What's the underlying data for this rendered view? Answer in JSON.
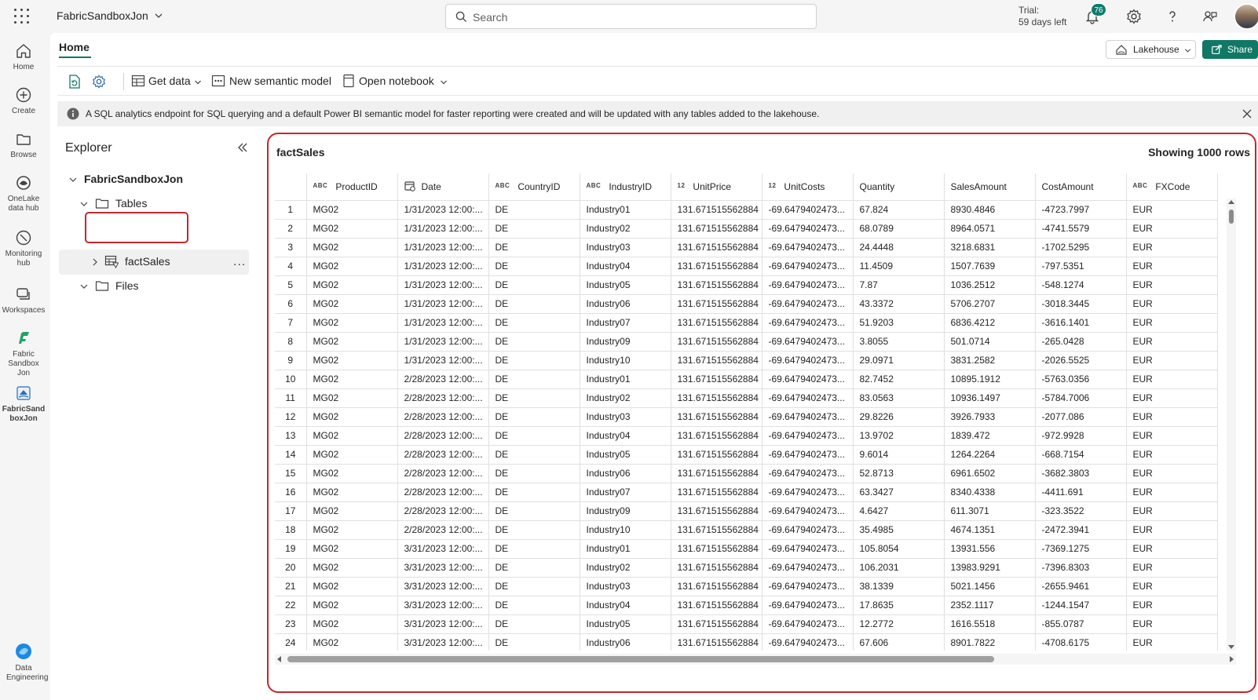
{
  "topbar": {
    "workspace": "FabricSandboxJon",
    "search_placeholder": "Search",
    "trial_line1": "Trial:",
    "trial_line2": "59 days left",
    "notification_count": "76"
  },
  "rail": [
    {
      "label": "Home",
      "icon": "home-icon"
    },
    {
      "label": "Create",
      "icon": "create-icon"
    },
    {
      "label": "Browse",
      "icon": "browse-icon"
    },
    {
      "label": "OneLake data hub",
      "icon": "onelake-icon"
    },
    {
      "label": "Monitoring hub",
      "icon": "monitoring-icon"
    },
    {
      "label": "Workspaces",
      "icon": "workspaces-icon"
    },
    {
      "label": "Fabric Sandbox Jon",
      "icon": "fabric-icon"
    },
    {
      "label": "FabricSandboxJon",
      "icon": "lakehouse-icon"
    },
    {
      "label": "Data Engineering",
      "icon": "data-engineering-icon"
    }
  ],
  "ribbon": {
    "tab": "Home",
    "lakehouse_label": "Lakehouse",
    "share_label": "Share",
    "get_data": "Get data",
    "new_semantic_model": "New semantic model",
    "open_notebook": "Open notebook"
  },
  "info": {
    "message": "A SQL analytics endpoint for SQL querying and a default Power BI semantic model for faster reporting were created and will be updated with any tables added to the lakehouse."
  },
  "explorer": {
    "title": "Explorer",
    "root": "FabricSandboxJon",
    "tables": "Tables",
    "table_item": "factSales",
    "files": "Files",
    "more": "..."
  },
  "grid": {
    "title": "factSales",
    "count": "Showing 1000 rows",
    "columns": [
      {
        "type": "ABC",
        "name": "ProductID"
      },
      {
        "type": "date",
        "name": "Date"
      },
      {
        "type": "ABC",
        "name": "CountryID"
      },
      {
        "type": "ABC",
        "name": "IndustryID"
      },
      {
        "type": "12",
        "name": "UnitPrice"
      },
      {
        "type": "12",
        "name": "UnitCosts"
      },
      {
        "type": "",
        "name": "Quantity"
      },
      {
        "type": "",
        "name": "SalesAmount"
      },
      {
        "type": "",
        "name": "CostAmount"
      },
      {
        "type": "ABC",
        "name": "FXCode"
      }
    ],
    "rows": [
      [
        "1",
        "MG02",
        "1/31/2023 12:00:...",
        "DE",
        "Industry01",
        "131.671515562884",
        "-69.6479402473...",
        "67.824",
        "8930.4846",
        "-4723.7997",
        "EUR"
      ],
      [
        "2",
        "MG02",
        "1/31/2023 12:00:...",
        "DE",
        "Industry02",
        "131.671515562884",
        "-69.6479402473...",
        "68.0789",
        "8964.0571",
        "-4741.5579",
        "EUR"
      ],
      [
        "3",
        "MG02",
        "1/31/2023 12:00:...",
        "DE",
        "Industry03",
        "131.671515562884",
        "-69.6479402473...",
        "24.4448",
        "3218.6831",
        "-1702.5295",
        "EUR"
      ],
      [
        "4",
        "MG02",
        "1/31/2023 12:00:...",
        "DE",
        "Industry04",
        "131.671515562884",
        "-69.6479402473...",
        "11.4509",
        "1507.7639",
        "-797.5351",
        "EUR"
      ],
      [
        "5",
        "MG02",
        "1/31/2023 12:00:...",
        "DE",
        "Industry05",
        "131.671515562884",
        "-69.6479402473...",
        "7.87",
        "1036.2512",
        "-548.1274",
        "EUR"
      ],
      [
        "6",
        "MG02",
        "1/31/2023 12:00:...",
        "DE",
        "Industry06",
        "131.671515562884",
        "-69.6479402473...",
        "43.3372",
        "5706.2707",
        "-3018.3445",
        "EUR"
      ],
      [
        "7",
        "MG02",
        "1/31/2023 12:00:...",
        "DE",
        "Industry07",
        "131.671515562884",
        "-69.6479402473...",
        "51.9203",
        "6836.4212",
        "-3616.1401",
        "EUR"
      ],
      [
        "8",
        "MG02",
        "1/31/2023 12:00:...",
        "DE",
        "Industry09",
        "131.671515562884",
        "-69.6479402473...",
        "3.8055",
        "501.0714",
        "-265.0428",
        "EUR"
      ],
      [
        "9",
        "MG02",
        "1/31/2023 12:00:...",
        "DE",
        "Industry10",
        "131.671515562884",
        "-69.6479402473...",
        "29.0971",
        "3831.2582",
        "-2026.5525",
        "EUR"
      ],
      [
        "10",
        "MG02",
        "2/28/2023 12:00:...",
        "DE",
        "Industry01",
        "131.671515562884",
        "-69.6479402473...",
        "82.7452",
        "10895.1912",
        "-5763.0356",
        "EUR"
      ],
      [
        "11",
        "MG02",
        "2/28/2023 12:00:...",
        "DE",
        "Industry02",
        "131.671515562884",
        "-69.6479402473...",
        "83.0563",
        "10936.1497",
        "-5784.7006",
        "EUR"
      ],
      [
        "12",
        "MG02",
        "2/28/2023 12:00:...",
        "DE",
        "Industry03",
        "131.671515562884",
        "-69.6479402473...",
        "29.8226",
        "3926.7933",
        "-2077.086",
        "EUR"
      ],
      [
        "13",
        "MG02",
        "2/28/2023 12:00:...",
        "DE",
        "Industry04",
        "131.671515562884",
        "-69.6479402473...",
        "13.9702",
        "1839.472",
        "-972.9928",
        "EUR"
      ],
      [
        "14",
        "MG02",
        "2/28/2023 12:00:...",
        "DE",
        "Industry05",
        "131.671515562884",
        "-69.6479402473...",
        "9.6014",
        "1264.2264",
        "-668.7154",
        "EUR"
      ],
      [
        "15",
        "MG02",
        "2/28/2023 12:00:...",
        "DE",
        "Industry06",
        "131.671515562884",
        "-69.6479402473...",
        "52.8713",
        "6961.6502",
        "-3682.3803",
        "EUR"
      ],
      [
        "16",
        "MG02",
        "2/28/2023 12:00:...",
        "DE",
        "Industry07",
        "131.671515562884",
        "-69.6479402473...",
        "63.3427",
        "8340.4338",
        "-4411.691",
        "EUR"
      ],
      [
        "17",
        "MG02",
        "2/28/2023 12:00:...",
        "DE",
        "Industry09",
        "131.671515562884",
        "-69.6479402473...",
        "4.6427",
        "611.3071",
        "-323.3522",
        "EUR"
      ],
      [
        "18",
        "MG02",
        "2/28/2023 12:00:...",
        "DE",
        "Industry10",
        "131.671515562884",
        "-69.6479402473...",
        "35.4985",
        "4674.1351",
        "-2472.3941",
        "EUR"
      ],
      [
        "19",
        "MG02",
        "3/31/2023 12:00:...",
        "DE",
        "Industry01",
        "131.671515562884",
        "-69.6479402473...",
        "105.8054",
        "13931.556",
        "-7369.1275",
        "EUR"
      ],
      [
        "20",
        "MG02",
        "3/31/2023 12:00:...",
        "DE",
        "Industry02",
        "131.671515562884",
        "-69.6479402473...",
        "106.2031",
        "13983.9291",
        "-7396.8303",
        "EUR"
      ],
      [
        "21",
        "MG02",
        "3/31/2023 12:00:...",
        "DE",
        "Industry03",
        "131.671515562884",
        "-69.6479402473...",
        "38.1339",
        "5021.1456",
        "-2655.9461",
        "EUR"
      ],
      [
        "22",
        "MG02",
        "3/31/2023 12:00:...",
        "DE",
        "Industry04",
        "131.671515562884",
        "-69.6479402473...",
        "17.8635",
        "2352.1117",
        "-1244.1547",
        "EUR"
      ],
      [
        "23",
        "MG02",
        "3/31/2023 12:00:...",
        "DE",
        "Industry05",
        "131.671515562884",
        "-69.6479402473...",
        "12.2772",
        "1616.5518",
        "-855.0787",
        "EUR"
      ],
      [
        "24",
        "MG02",
        "3/31/2023 12:00:...",
        "DE",
        "Industry06",
        "131.671515562884",
        "-69.6479402473...",
        "67.606",
        "8901.7822",
        "-4708.6175",
        "EUR"
      ]
    ]
  },
  "colors": {
    "accent": "#117865",
    "highlight": "#c4262e"
  }
}
